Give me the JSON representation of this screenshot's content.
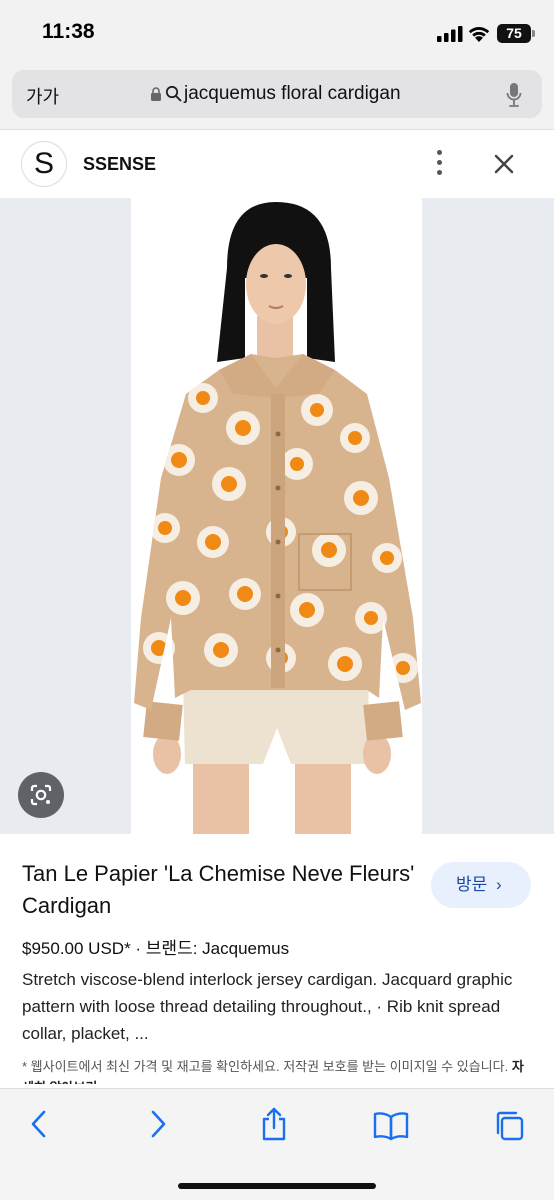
{
  "status": {
    "time": "11:38",
    "battery": "75"
  },
  "browser": {
    "text_size_label": "가가",
    "url_text": "jacquemus floral cardigan"
  },
  "source": {
    "avatar_letter": "S",
    "site_name": "SSENSE"
  },
  "product": {
    "title": "Tan Le Papier 'La Chemise Neve Fleurs' Cardigan",
    "visit_label": "방문",
    "visit_chevron": "›",
    "price_line": "$950.00 USD* · 브랜드: Jacquemus",
    "description": "Stretch viscose-blend interlock jersey cardigan. Jacquard graphic pattern with loose thread detailing throughout., · Rib knit spread collar, placket, ...",
    "note_text": "* 웹사이트에서 최신 가격 및 재고를 확인하세요. 저작권 보호를 받는 이미지일 수 있습니다.",
    "note_link": "자세히 알아보기"
  },
  "colors": {
    "accent": "#1a4aa8",
    "visit_bg": "#e8f0fe",
    "flower_orange": "#f08a14",
    "cardigan_tan": "#d8b48e"
  },
  "icons": [
    "lock-icon",
    "search-icon",
    "mic-icon",
    "more-vert-icon",
    "close-icon",
    "lens-icon",
    "back-icon",
    "forward-icon",
    "share-icon",
    "bookmarks-icon",
    "tabs-icon"
  ]
}
